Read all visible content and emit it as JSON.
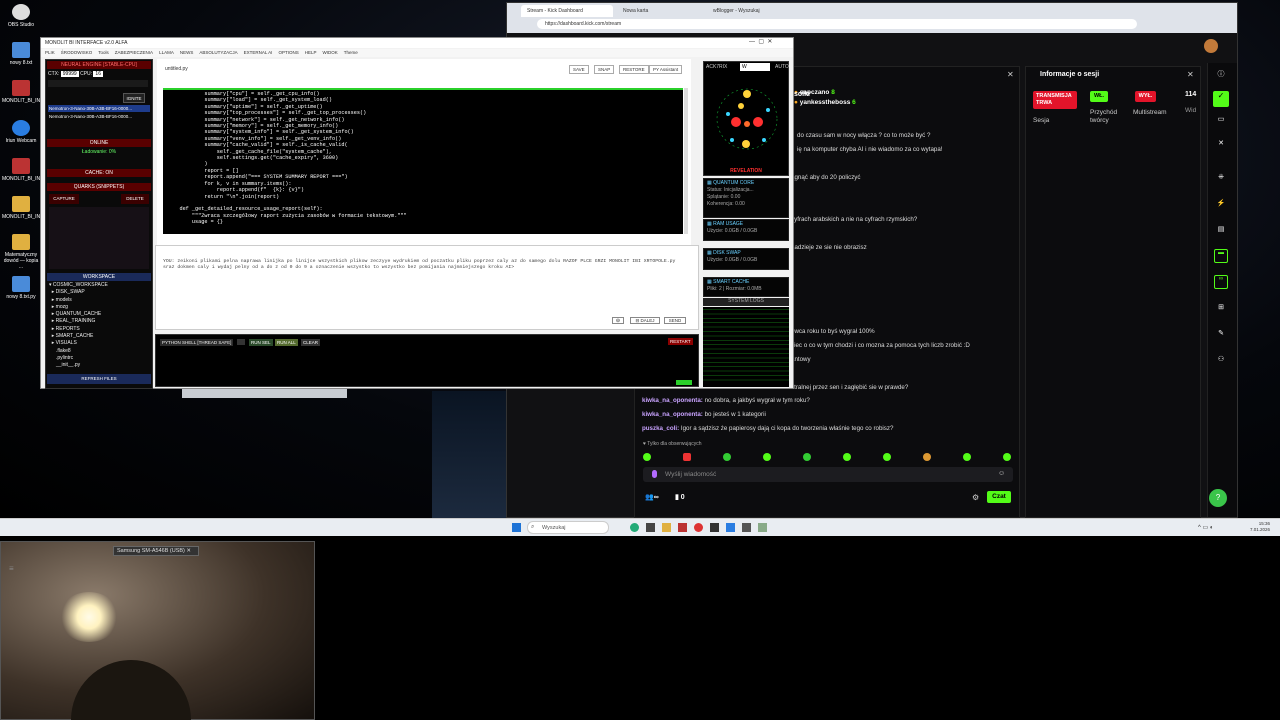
{
  "desktop": {
    "icons": [
      {
        "label": "OBS Studio",
        "color": "#ddd"
      },
      {
        "label": "nowy 8.txt",
        "color": "#4a8bd9"
      },
      {
        "label": "MONOLIT_BI_INTE...",
        "color": "#b33"
      },
      {
        "label": "Iriun Webcam",
        "color": "#2a7de1"
      },
      {
        "label": "MONOLIT_BI_INTE...",
        "color": "#b33"
      },
      {
        "label": "MONOLIT_BI_INTE...",
        "color": "#e0b040"
      },
      {
        "label": "MONOLIT_BI_INTE...",
        "color": "#e0b040"
      },
      {
        "label": "Matematyczny dowód — kopia ...",
        "color": "#e0b040"
      },
      {
        "label": "nowy 8.txt.py",
        "color": "#4a8bd9"
      }
    ]
  },
  "browser": {
    "tabs": [
      "Stream - Kick Dashboard",
      "Nowa karta",
      "wBlogger - Wyszukaj"
    ],
    "url": "https://dashboard.kick.com/stream",
    "chat_lines": [
      {
        "user": "",
        "text": "solki"
      },
      {
        "user": "",
        "text": "do czasu sam w nocy włącza ? co to może być ?"
      },
      {
        "user": "",
        "text": "ię na komputer chyba AI i nie wiadomo za co wytapa!"
      },
      {
        "user": "",
        "text": "ągnąć aby do 20 policzyć"
      },
      {
        "user": "",
        "text": "cyfrach arabskich a nie na cyfrach rzymskich?"
      },
      {
        "user": "",
        "text": "nadzieje ze sie nie obrazisz"
      },
      {
        "user": "",
        "text": "owca roku to byś wygrał 100%"
      },
      {
        "user": "",
        "text": "ziec o co w tym chodzi i co mozna za pomoca tych liczb zrobić :D"
      },
      {
        "user": "",
        "text": "antowy"
      },
      {
        "user": "",
        "text": "stralnej przez sen i zagłębić sie w prawde?"
      },
      {
        "user": "kiwka_na_oponenta:",
        "text": " no dobra, a jakbyś wygrał w tym roku?"
      },
      {
        "user": "kiwka_na_oponenta:",
        "text": " bo jesteś w 1 kategorii"
      },
      {
        "user": "puszka_coli:",
        "text": " Igor a sądzisz że papierosy dają ci kopa do tworzenia właśnie tego co robisz?"
      }
    ],
    "top_users": [
      {
        "name": "sapczano",
        "count": "8"
      },
      {
        "name": "yankesstheboss",
        "count": "6"
      }
    ],
    "followers_only": "Tylko dla obserwujących",
    "message_placeholder": "Wyślij wiadomość",
    "chat_button": "Czat",
    "viewers": "∞",
    "count_zero": "0",
    "session": {
      "title": "Informacje o sesji",
      "live_badge": "TRANSMISJA TRWA",
      "session_label": "Sesja",
      "on_badge": "WŁ.",
      "income_label": "Przychód twórcy",
      "off_badge": "WYŁ.",
      "multistream_label": "Multistream",
      "views_value": "114",
      "views_label": "Wid"
    }
  },
  "ide": {
    "title": "MONOLIT BI INTERFACE v2.0 ALFA",
    "menu": [
      "PLIK",
      "ŚRODOWISKO",
      "Tools",
      "ZABEZPIECZENIA",
      "LLAMA",
      "NEWS",
      "ABSOLUTYZACJA",
      "EXTERNAL AI",
      "OPTIONS",
      "HELP",
      "WIDOK",
      "Theme"
    ],
    "engine_title": "NEURAL ENGINE [STABLE-CPU]",
    "ctx_label": "CTX:",
    "ctx_value": "99999",
    "cpu_label": "CPU:",
    "cpu_value": "16",
    "ignite": "IGNITE",
    "models": [
      "Nemotron-3-Nano-30B-A3B-BF16-0000...",
      "Nemotron-3-Nano-30B-A3B-BF16-0000..."
    ],
    "status_online": "ONLINE",
    "loading": "Ładowanie: 0%",
    "cache_on": "CACHE: ON",
    "quarks_title": "QUARKS (SNIPPETS)",
    "capture": "CAPTURE",
    "delete": "DELETE",
    "workspace_title": "WORKSPACE",
    "workspace_items": [
      "▾ COSMIC_WORKSPACE",
      "  ▸ DISK_SWAP",
      "  ▸ models",
      "  ▸ mozg",
      "  ▸ QUANTUM_CACHE",
      "  ▸ REAL_TRAINING",
      "  ▸ REPORTS",
      "  ▸ SMART_CACHE",
      "  ▸ VISUALS",
      "     .flake8",
      "     .pylintrc",
      "     __init__.py"
    ],
    "refresh": "REFRESH FILES",
    "filename": "untitled.py",
    "toolbar": [
      "SAVE",
      "SNAP",
      "RESTORE",
      "PY Assistant"
    ],
    "code": "            summary[\"cpu\"] = self._get_cpu_info()\n            summary[\"load\"] = self._get_system_load()\n            summary[\"uptime\"] = self._get_uptime()\n            summary[\"top_processes\"] = self._get_top_processes()\n            summary[\"network\"] = self._get_network_info()\n            summary[\"memory\"] = self._get_memory_info()\n            summary[\"system_info\"] = self._get_system_info()\n            summary[\"venv_info\"] = self._get_venv_info()\n            summary[\"cache_valid\"] = self._is_cache_valid(\n                self._get_cache_file(\"system_cache\"),\n                self.settings.get(\"cache_expiry\", 3600)\n            )\n            report = []\n            report.append(\"=== SYSTEM SUMMARY REPORT ===\")\n            for k, v in summary.items():\n                report.append(f\"  {k}: {v}\")\n            return \"\\n\".join(report)\n\n    def _get_detailed_resource_usage_report(self):\n        \"\"\"Zwraca szczegółowy raport zużycia zasobów w formacie tekstowym.\"\"\"\n        usage = {}",
    "prompt_text": "YOU: zeikoni plikami pelna naprawa linijka po linijce wszystkich plikow zeczyye wydrukiem od poczatku pliku poprzez caly az do samego dolu RAZOF PLCE GRZI MONOLIT IBI XRTOPOLE.py sraz dokmen caly i wydaj pelny od a do z od 0 do 9 a oznaczenie wszystko to wszystko bez pomijania najmniejszego kroku AI>",
    "send_next": "DALEJ",
    "send": "SEND",
    "shell_title": "PYTHON SHELL [THREAD SAFE]",
    "run_sel": "RUN SEL",
    "run_all": "RUN ALL",
    "clear": "CLEAR",
    "restart": "RESTART",
    "right": {
      "field_label": "ACK7RIX",
      "field_value": "W",
      "auto": "AUTO",
      "revelation": "REVELATION",
      "quantum_title": "QUANTUM CORE",
      "quantum_lines": [
        "Status: Inicjalizacja...",
        "Splątanie: 0.00",
        "Koherencja: 0.00"
      ],
      "ram_title": "RAM USAGE",
      "ram_value": "Użycie: 0.0GB / 0.0GB",
      "disk_title": "DISK SWAP",
      "disk_value": "Użycie: 0.0GB / 0.0GB",
      "smart_title": "SMART CACHE",
      "smart_value": "Pliki: 2 | Rozmiar: 0.0MB",
      "logs_title": "SYSTEM LOGS"
    }
  },
  "taskbar": {
    "search_placeholder": "Wyszukaj",
    "time": "15:36",
    "date": "7.01.2026"
  },
  "webcam": {
    "label": "Samsung SM-A546B (USB)"
  }
}
